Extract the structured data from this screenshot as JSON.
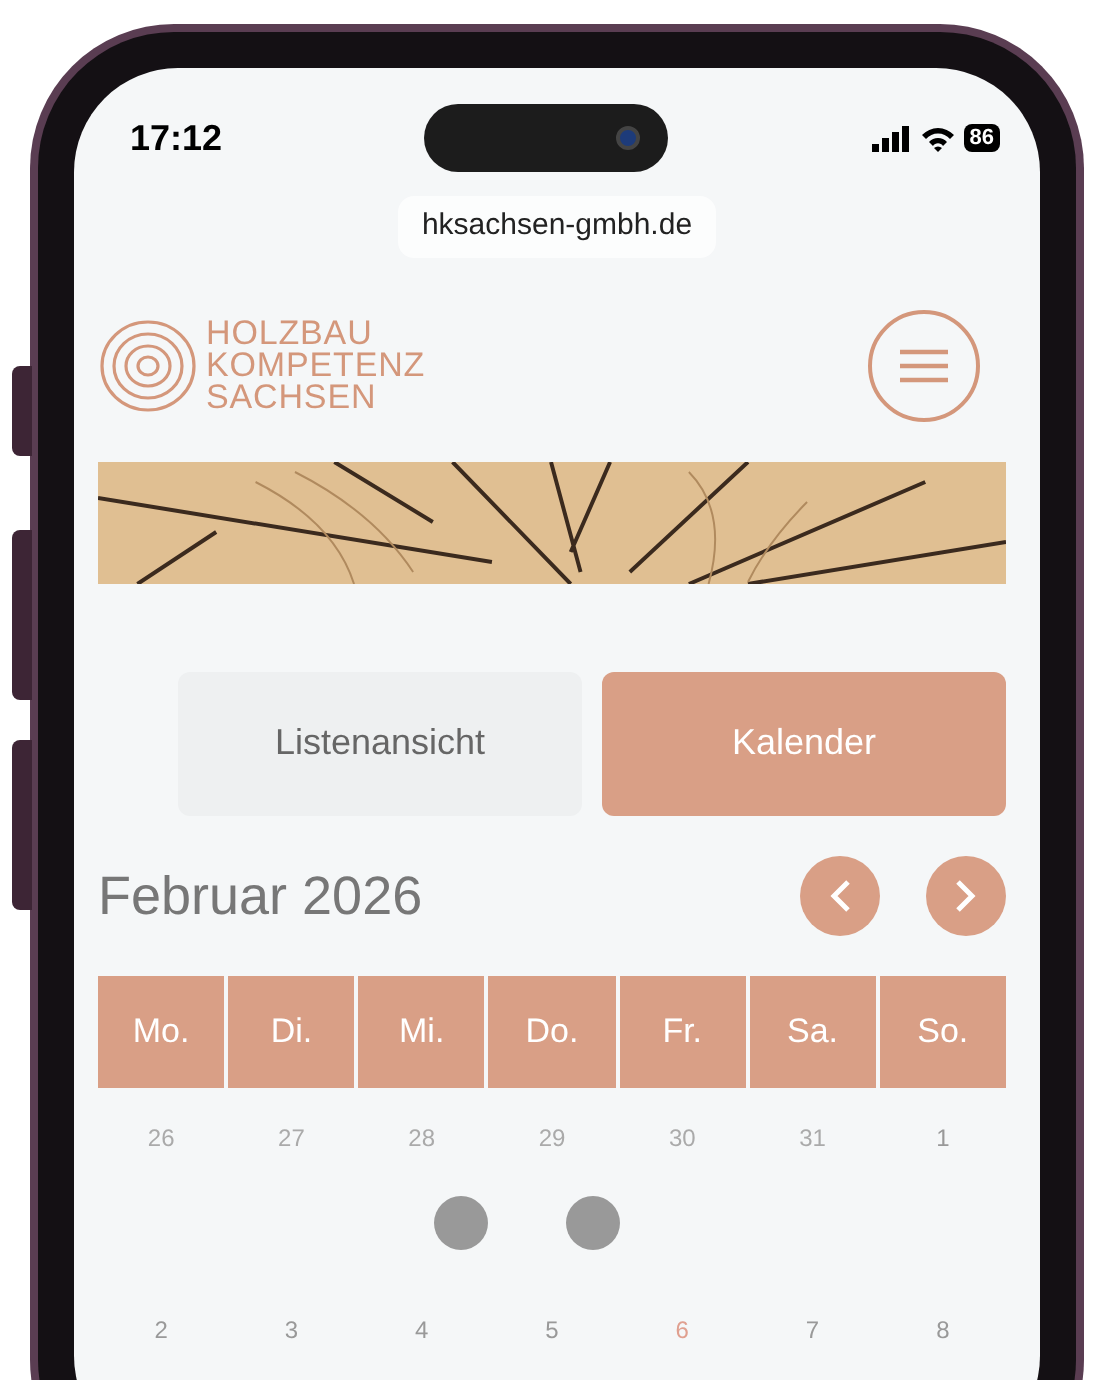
{
  "status_bar": {
    "time": "17:12",
    "battery": "86"
  },
  "browser": {
    "url": "hksachsen-gmbh.de"
  },
  "logo": {
    "lines": [
      "HOLZBAU",
      "KOMPETENZ",
      "SACHSEN"
    ]
  },
  "tabs": [
    {
      "label": "Listenansicht",
      "selected": false
    },
    {
      "label": "Kalender",
      "selected": true
    }
  ],
  "calendar": {
    "month": "Februar 2026",
    "weekdays": [
      "Mo.",
      "Di.",
      "Mi.",
      "Do.",
      "Fr.",
      "Sa.",
      "So."
    ],
    "weeks": [
      [
        {
          "day": "26",
          "outside": true,
          "today": false,
          "event": false
        },
        {
          "day": "27",
          "outside": true,
          "today": false,
          "event": false
        },
        {
          "day": "28",
          "outside": true,
          "today": false,
          "event": true
        },
        {
          "day": "29",
          "outside": true,
          "today": false,
          "event": true
        },
        {
          "day": "30",
          "outside": true,
          "today": false,
          "event": false
        },
        {
          "day": "31",
          "outside": true,
          "today": false,
          "event": false
        },
        {
          "day": "1",
          "outside": false,
          "today": false,
          "event": false
        }
      ],
      [
        {
          "day": "2",
          "outside": false,
          "today": false,
          "event": false
        },
        {
          "day": "3",
          "outside": false,
          "today": false,
          "event": false
        },
        {
          "day": "4",
          "outside": false,
          "today": false,
          "event": false
        },
        {
          "day": "5",
          "outside": false,
          "today": false,
          "event": false
        },
        {
          "day": "6",
          "outside": false,
          "today": true,
          "event": false
        },
        {
          "day": "7",
          "outside": false,
          "today": false,
          "event": false
        },
        {
          "day": "8",
          "outside": false,
          "today": false,
          "event": false
        }
      ]
    ]
  }
}
